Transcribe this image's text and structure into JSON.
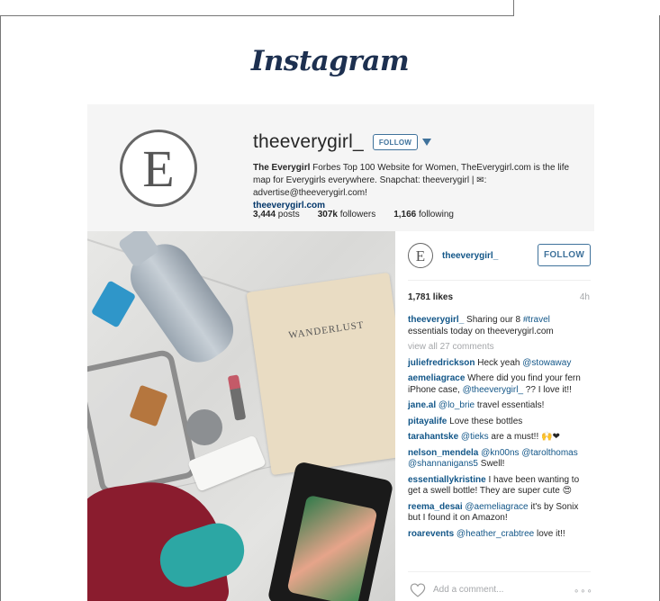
{
  "brand": {
    "logo": "Instagram"
  },
  "profile": {
    "avatar_letter": "E",
    "username": "theeverygirl_",
    "follow_label": "FOLLOW",
    "bio_name": "The Everygirl",
    "bio_text": " Forbes Top 100 Website for Women, TheEverygirl.com is the life map for Everygirls everywhere. Snapchat: theeverygirl | ✉: advertise@theeverygirl.com!",
    "website": "theeverygirl.com",
    "stats": {
      "posts_count": "3,444",
      "posts_label": " posts",
      "followers_count": "307k",
      "followers_label": " followers",
      "following_count": "1,166",
      "following_label": " following"
    }
  },
  "photo": {
    "notebook_text": "WANDERLUST"
  },
  "post": {
    "avatar_letter": "E",
    "username": "theeverygirl_",
    "follow_label": "FOLLOW",
    "likes": "1,781 likes",
    "time": "4h",
    "caption_user": "theeverygirl_",
    "caption_pre": " Sharing our 8 ",
    "caption_tag": "#travel",
    "caption_post": " essentials today on theeverygirl.com",
    "view_all": "view all 27 comments",
    "comments": [
      {
        "user": "juliefredrickson",
        "pre": " Heck yeah ",
        "mention": "@stowaway",
        "post": ""
      },
      {
        "user": "aemeliagrace",
        "pre": " Where did you find your fern iPhone case, ",
        "mention": "@theeverygirl_",
        "post": " ?? I love it!!"
      },
      {
        "user": "jane.al",
        "pre": " ",
        "mention": "@lo_brie",
        "post": " travel essentials!"
      },
      {
        "user": "pitayalife",
        "pre": " Love these bottles",
        "mention": "",
        "post": ""
      },
      {
        "user": "tarahantske",
        "pre": " ",
        "mention": "@tieks",
        "post": " are a must!! 🙌❤"
      },
      {
        "user": "nelson_mendela",
        "pre": " ",
        "mention": "@kn00ns @tarolthomas @shannanigans5",
        "post": " Swell!"
      },
      {
        "user": "essentiallykristine",
        "pre": " I have been wanting to get a swell bottle! They are super cute 😍",
        "mention": "",
        "post": ""
      },
      {
        "user": "reema_desai",
        "pre": " ",
        "mention": "@aemeliagrace",
        "post": " it's by Sonix but I found it on Amazon!"
      },
      {
        "user": "roarevents",
        "pre": " ",
        "mention": "@heather_crabtree",
        "post": " love it!!"
      }
    ],
    "add_comment_placeholder": "Add a comment...",
    "more_label": "∘∘∘"
  },
  "colors": {
    "link_blue": "#125688",
    "button_blue": "#3f729b",
    "logo_navy": "#1d3050"
  }
}
